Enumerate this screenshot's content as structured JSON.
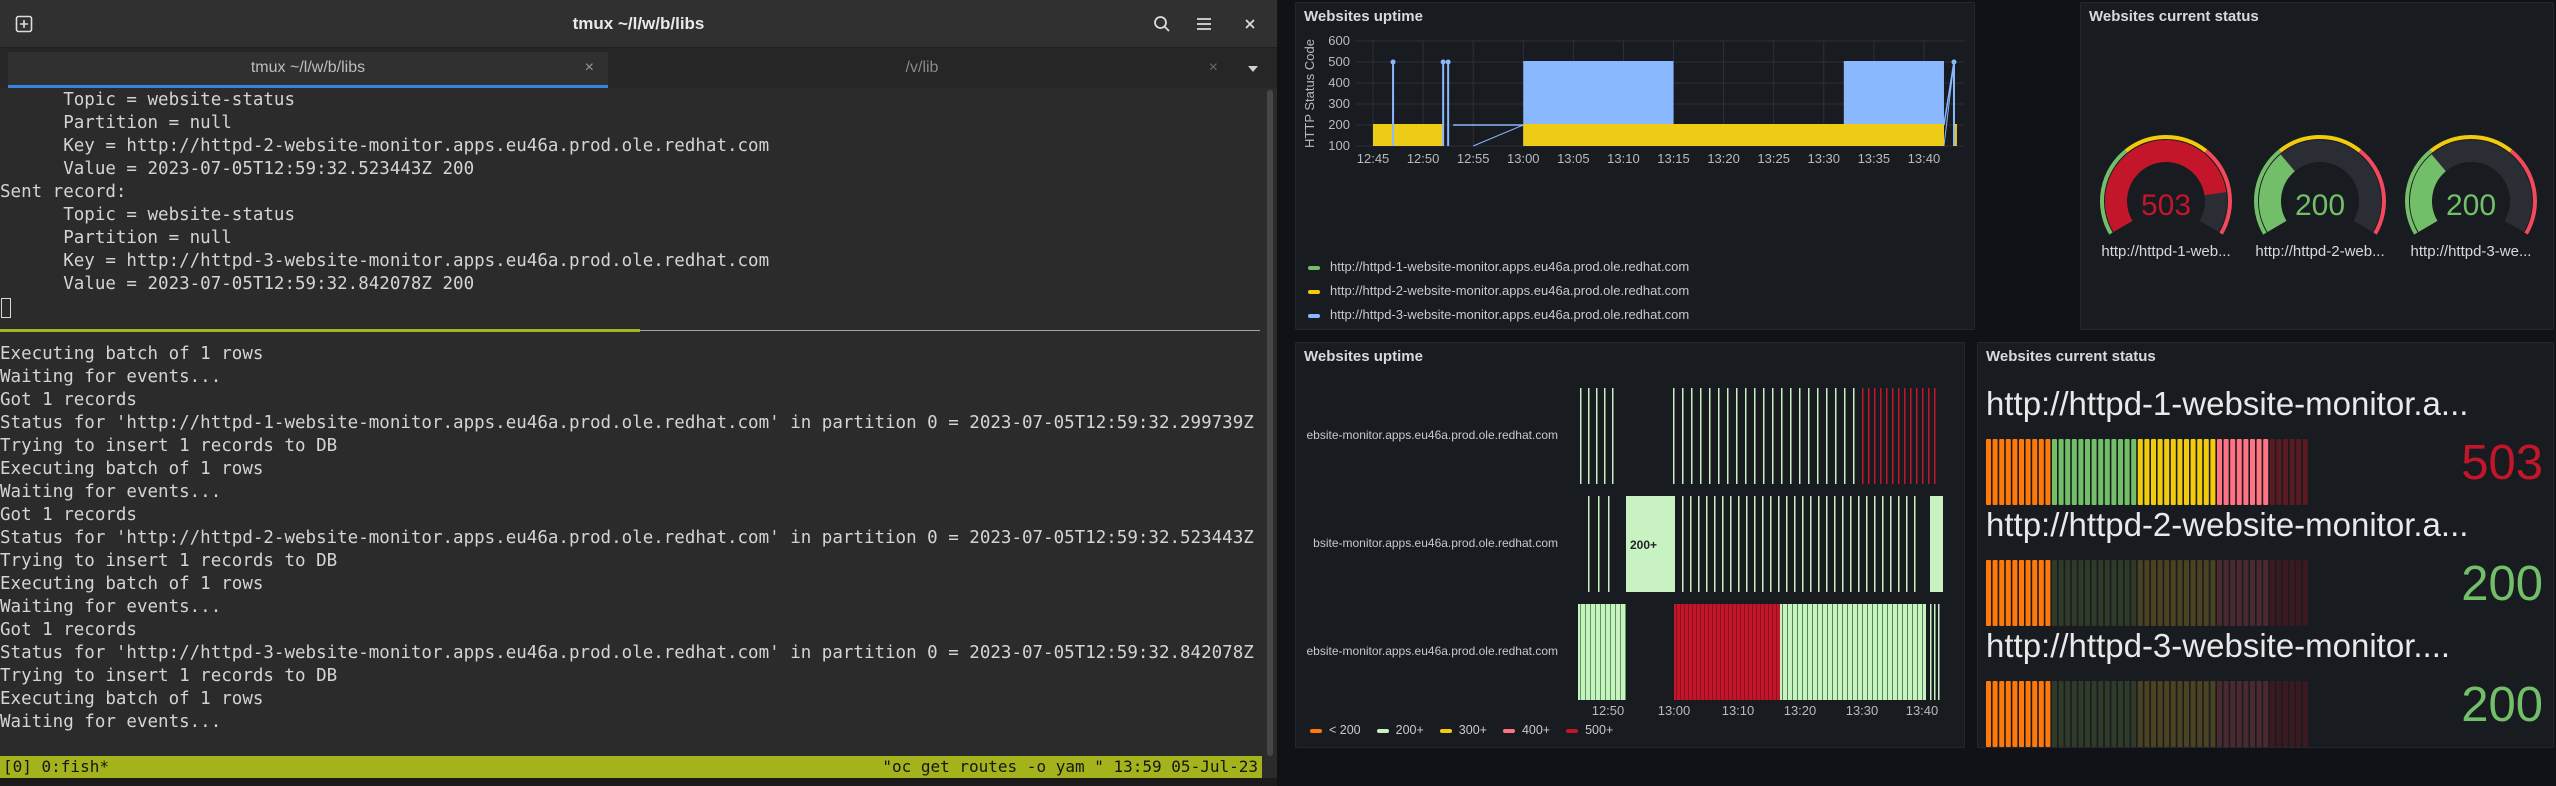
{
  "terminal": {
    "title": "tmux ~/l/w/b/libs",
    "tabs": [
      {
        "label": "tmux ~/l/w/b/libs",
        "close": "×"
      },
      {
        "label": "/v/lib",
        "close": "×"
      }
    ],
    "icons": [
      "new-tab-icon",
      "search-icon",
      "hamburger-menu-icon",
      "close-icon",
      "chevron-down-icon"
    ],
    "pane_top_lines": [
      "      Topic = website-status",
      "      Partition = null",
      "      Key = http://httpd-2-website-monitor.apps.eu46a.prod.ole.redhat.com",
      "      Value = 2023-07-05T12:59:32.523443Z 200",
      "Sent record:",
      "      Topic = website-status",
      "      Partition = null",
      "      Key = http://httpd-3-website-monitor.apps.eu46a.prod.ole.redhat.com",
      "      Value = 2023-07-05T12:59:32.842078Z 200"
    ],
    "pane_bottom_lines": [
      "Executing batch of 1 rows",
      "Waiting for events...",
      "Got 1 records",
      "Status for 'http://httpd-1-website-monitor.apps.eu46a.prod.ole.redhat.com' in partition 0 = 2023-07-05T12:59:32.299739Z 503",
      "Trying to insert 1 records to DB",
      "Executing batch of 1 rows",
      "Waiting for events...",
      "Got 1 records",
      "Status for 'http://httpd-2-website-monitor.apps.eu46a.prod.ole.redhat.com' in partition 0 = 2023-07-05T12:59:32.523443Z 200",
      "Trying to insert 1 records to DB",
      "Executing batch of 1 rows",
      "Waiting for events...",
      "Got 1 records",
      "Status for 'http://httpd-3-website-monitor.apps.eu46a.prod.ole.redhat.com' in partition 0 = 2023-07-05T12:59:32.842078Z 200",
      "Trying to insert 1 records to DB",
      "Executing batch of 1 rows",
      "Waiting for events..."
    ],
    "status_left": "[0] 0:fish*",
    "status_right": "\"oc get routes -o yam \" 13:59 05-Jul-23"
  },
  "colors": {
    "green": "#73bf69",
    "yellow": "#f2cc0c",
    "blue": "#8ab8ff",
    "red": "#c4162a",
    "orange": "#ff780a",
    "light_green": "#c8f2c2",
    "light_red": "#ff7383",
    "tmux_status": "#a4b31c",
    "tab_accent": "#3584e4"
  },
  "grafana": {
    "uptime_timeseries": {
      "title": "Websites uptime",
      "chart_data": {
        "type": "area",
        "ylabel": "HTTP Status Code",
        "ylim": [
          100,
          600
        ],
        "yticks": [
          100,
          200,
          300,
          400,
          500,
          600
        ],
        "xticks": [
          "12:45",
          "12:50",
          "12:55",
          "13:00",
          "13:05",
          "13:10",
          "13:15",
          "13:20",
          "13:25",
          "13:30",
          "13:35",
          "13:40"
        ],
        "series": [
          {
            "name": "http://httpd-1-website-monitor.apps.eu46a.prod.ole.redhat.com",
            "color": "#73bf69",
            "segments": []
          },
          {
            "name": "http://httpd-2-website-monitor.apps.eu46a.prod.ole.redhat.com",
            "color": "#f2cc0c",
            "segments": [
              {
                "from": "12:45",
                "to": "12:52",
                "value": 200
              },
              {
                "from": "13:00",
                "to": "13:42",
                "value": 200
              },
              {
                "from": "13:43",
                "to": "13:43",
                "value": 200
              }
            ]
          },
          {
            "name": "http://httpd-3-website-monitor.apps.eu46a.prod.ole.redhat.com",
            "color": "#8ab8ff",
            "segments": [
              {
                "from": "12:45",
                "to": "12:52",
                "value": 200
              },
              {
                "from": "13:00",
                "to": "13:15",
                "value": 500
              },
              {
                "from": "13:15",
                "to": "13:32",
                "value": 200
              },
              {
                "from": "13:32",
                "to": "13:42",
                "value": 500
              }
            ]
          }
        ],
        "spikes": [
          {
            "at": "12:47",
            "value": 500
          },
          {
            "at": "12:52",
            "value": 500
          },
          {
            "at": "12:52.5",
            "value": 500
          },
          {
            "at": "13:43",
            "value": 500
          }
        ],
        "grid": true,
        "legend_placement": "bottom"
      }
    },
    "current_status_gauges": {
      "title": "Websites current status",
      "chart_data": {
        "type": "gauge",
        "min": 0,
        "max": 600,
        "gauges": [
          {
            "label": "http://httpd-1-web...",
            "value": 503,
            "display": "503",
            "color": "#c4162a"
          },
          {
            "label": "http://httpd-2-web...",
            "value": 200,
            "display": "200",
            "color": "#73bf69"
          },
          {
            "label": "http://httpd-3-we...",
            "value": 200,
            "display": "200",
            "color": "#73bf69"
          }
        ]
      }
    },
    "uptime_history": {
      "title": "Websites uptime",
      "chart_data": {
        "type": "heatmap",
        "rows": [
          {
            "label": "ebsite-monitor.apps.eu46a.prod.ole.redhat.com"
          },
          {
            "label": "bsite-monitor.apps.eu46a.prod.ole.redhat.com",
            "value_label": "200+"
          },
          {
            "label": "ebsite-monitor.apps.eu46a.prod.ole.redhat.com"
          }
        ],
        "xticks": [
          "12:50",
          "13:00",
          "13:10",
          "13:20",
          "13:30",
          "13:40"
        ],
        "legend": [
          {
            "label": "< 200",
            "color": "#ff780a"
          },
          {
            "label": "200+",
            "color": "#c8f2c2"
          },
          {
            "label": "300+",
            "color": "#f2cc0c"
          },
          {
            "label": "400+",
            "color": "#ff7383"
          },
          {
            "label": "500+",
            "color": "#c4162a"
          }
        ]
      }
    },
    "current_status_stats": {
      "title": "Websites current status",
      "stats": [
        {
          "url": "http://httpd-1-website-monitor.a...",
          "value": "503",
          "color": "#c4162a"
        },
        {
          "url": "http://httpd-2-website-monitor.a...",
          "value": "200",
          "color": "#73bf69"
        },
        {
          "url": "http://httpd-3-website-monitor....",
          "value": "200",
          "color": "#73bf69"
        }
      ]
    }
  }
}
